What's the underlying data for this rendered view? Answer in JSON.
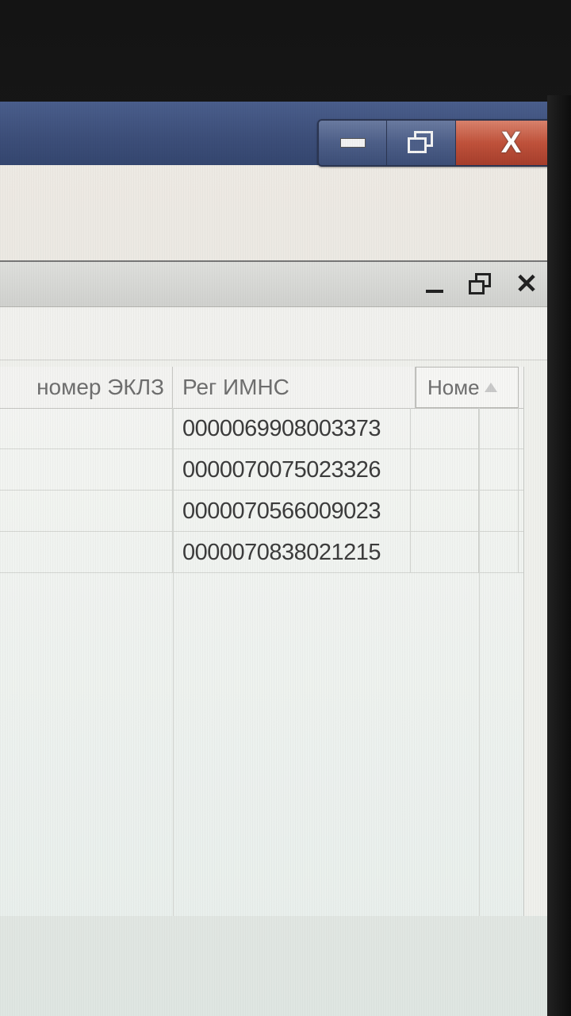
{
  "outer_window": {
    "controls": {
      "minimize_icon": "minimize-icon",
      "restore_icon": "restore-icon",
      "close_label": "X"
    },
    "colors": {
      "titlebar": "#3d4f7a",
      "close_button": "#c0523b"
    }
  },
  "inner_window": {
    "controls": {
      "minimize_icon": "minimize-icon",
      "restore_icon": "restore-icon",
      "close_label": "✕"
    }
  },
  "grid": {
    "columns": [
      {
        "label": "номер ЭКЛЗ"
      },
      {
        "label": "Рег ИМНС"
      },
      {
        "label": "Номе"
      }
    ],
    "rows": [
      {
        "ekpz": "",
        "reg_imns": "0000069908003373",
        "nomer": ""
      },
      {
        "ekpz": "",
        "reg_imns": "0000070075023326",
        "nomer": ""
      },
      {
        "ekpz": "",
        "reg_imns": "0000070566009023",
        "nomer": ""
      },
      {
        "ekpz": "",
        "reg_imns": "0000070838021215",
        "nomer": ""
      }
    ]
  }
}
